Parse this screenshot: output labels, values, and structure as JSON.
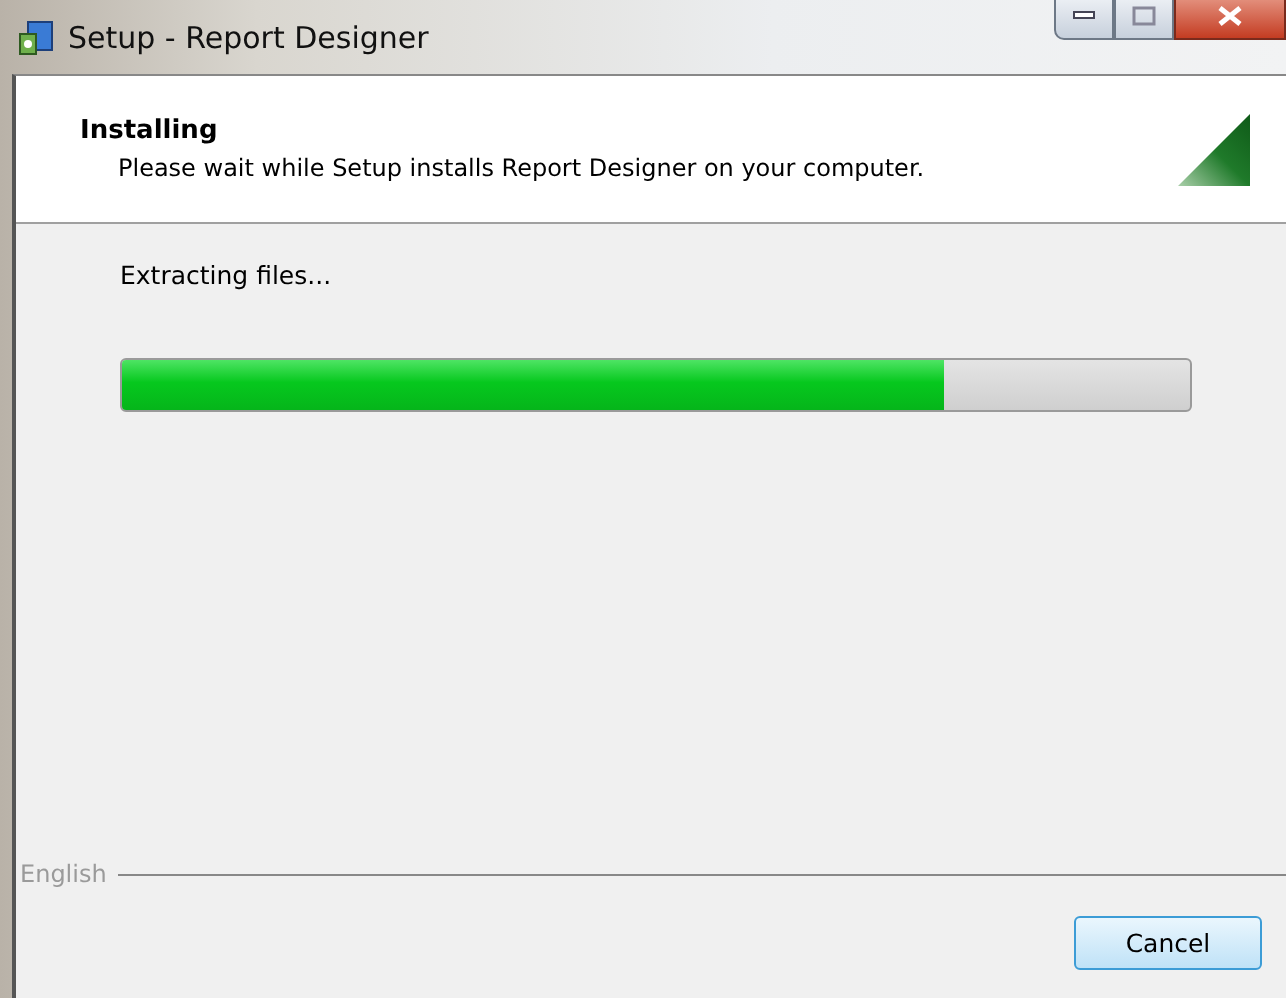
{
  "window": {
    "title": "Setup - Report Designer"
  },
  "header": {
    "title": "Installing",
    "subtitle": "Please wait while Setup installs Report Designer on your computer."
  },
  "status": "Extracting files...",
  "progress": {
    "level": 0.77
  },
  "footer": {
    "language": "English",
    "buttons": [
      "Cancel"
    ]
  }
}
